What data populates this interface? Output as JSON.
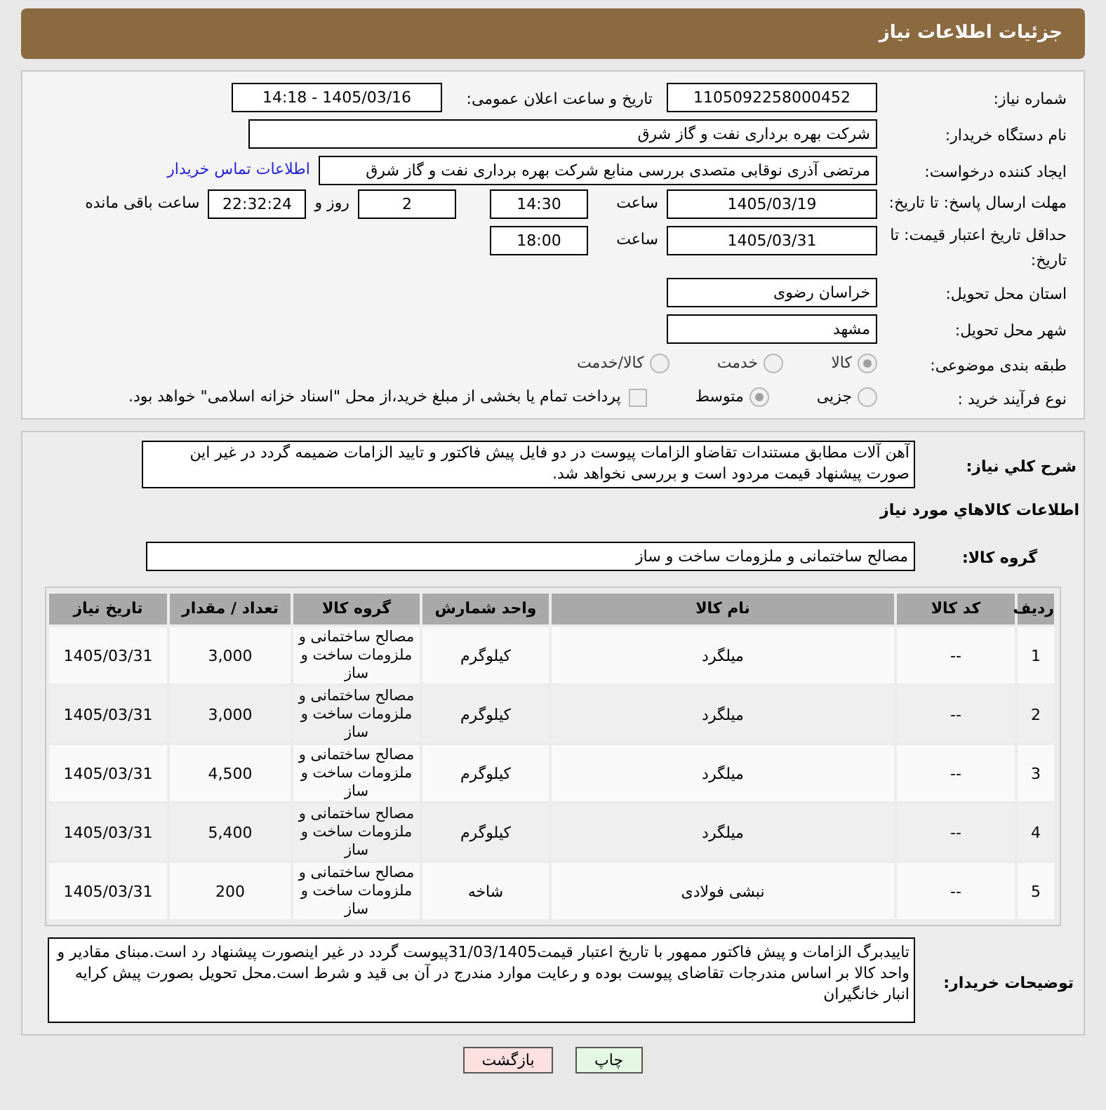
{
  "header": {
    "title": "جزئیات اطلاعات نیاز"
  },
  "fields": {
    "need_number": {
      "label": "شماره نیاز:",
      "value": "1105092258000452"
    },
    "announce": {
      "label": "تاریخ و ساعت اعلان عمومی:",
      "value": "1405/03/16 - 14:18"
    },
    "buyer": {
      "label": "نام دستگاه خریدار:",
      "value": "شرکت بهره برداری نفت و گاز شرق"
    },
    "creator": {
      "label": "ایجاد کننده درخواست:",
      "value": "مرتضی آذری نوقابی متصدی بررسی منابع شرکت بهره برداری نفت و گاز شرق",
      "link": "اطلاعات تماس خریدار"
    },
    "deadline": {
      "label": "مهلت ارسال پاسخ: تا تاریخ:",
      "date": "1405/03/19",
      "time_label": "ساعت",
      "time": "14:30",
      "days": "2",
      "days_label": "روز و",
      "remaining": "22:32:24",
      "remaining_label": "ساعت باقی مانده"
    },
    "validity": {
      "label": "حداقل تاریخ اعتبار قیمت: تا تاریخ:",
      "date": "1405/03/31",
      "time_label": "ساعت",
      "time": "18:00"
    },
    "province": {
      "label": "استان محل تحویل:",
      "value": "خراسان رضوی"
    },
    "city": {
      "label": "شهر محل تحویل:",
      "value": "مشهد"
    },
    "category": {
      "label": "طبقه بندی موضوعی:",
      "options": [
        {
          "label": "کالا",
          "selected": true
        },
        {
          "label": "خدمت",
          "selected": false
        },
        {
          "label": "کالا/خدمت",
          "selected": false
        }
      ]
    },
    "process": {
      "label": "نوع فرآیند خرید :",
      "options": [
        {
          "label": "جزیی",
          "selected": false
        },
        {
          "label": "متوسط",
          "selected": true
        }
      ],
      "treasury": {
        "label": "پرداخت تمام یا بخشی از مبلغ خرید،از محل \"اسناد خزانه اسلامی\" خواهد بود.",
        "checked": false
      }
    }
  },
  "summary": {
    "label": "شرح كلي نياز:",
    "value": "آهن آلات مطابق مستندات تقاضاو الزامات پیوست در دو فایل پیش فاکتور و تایید الزامات ضمیمه گردد در غیر این صورت پیشنهاد قیمت مردود است و بررسی نخواهد شد."
  },
  "goods_heading": "اطلاعات كالاهاي مورد نياز",
  "goods_group": {
    "label": "گروه کالا:",
    "value": "مصالح ساختمانی و ملزومات ساخت و ساز"
  },
  "table": {
    "columns": [
      "ردیف",
      "کد کالا",
      "نام کالا",
      "واحد شمارش",
      "گروه کالا",
      "تعداد / مقدار",
      "تاریخ نیاز"
    ],
    "rows": [
      [
        "1",
        "--",
        "میلگرد",
        "کیلوگرم",
        "مصالح ساختمانی و ملزومات ساخت و ساز",
        "3,000",
        "1405/03/31"
      ],
      [
        "2",
        "--",
        "میلگرد",
        "کیلوگرم",
        "مصالح ساختمانی و ملزومات ساخت و ساز",
        "3,000",
        "1405/03/31"
      ],
      [
        "3",
        "--",
        "میلگرد",
        "کیلوگرم",
        "مصالح ساختمانی و ملزومات ساخت و ساز",
        "4,500",
        "1405/03/31"
      ],
      [
        "4",
        "--",
        "میلگرد",
        "کیلوگرم",
        "مصالح ساختمانی و ملزومات ساخت و ساز",
        "5,400",
        "1405/03/31"
      ],
      [
        "5",
        "--",
        "نبشی فولادی",
        "شاخه",
        "مصالح ساختمانی و ملزومات ساخت و ساز",
        "200",
        "1405/03/31"
      ]
    ]
  },
  "buyer_notes": {
    "label": "توضیحات خریدار:",
    "value": "تاییدبرگ الزامات و پیش فاکتور ممهور با تاریخ اعتبار قیمت31/03/1405پیوست گردد در غیر اینصورت پیشنهاد رد است.مبنای مقادیر و واحد کالا بر اساس مندرجات تقاضای پیوست بوده و رعایت موارد مندرج در آن بی قید و شرط است.محل تحویل بصورت پیش کرایه انبار خانگیران"
  },
  "buttons": [
    {
      "label": "چاپ",
      "color": "#e4f8e4"
    },
    {
      "label": "بازگشت",
      "color": "#fde0e0"
    }
  ]
}
